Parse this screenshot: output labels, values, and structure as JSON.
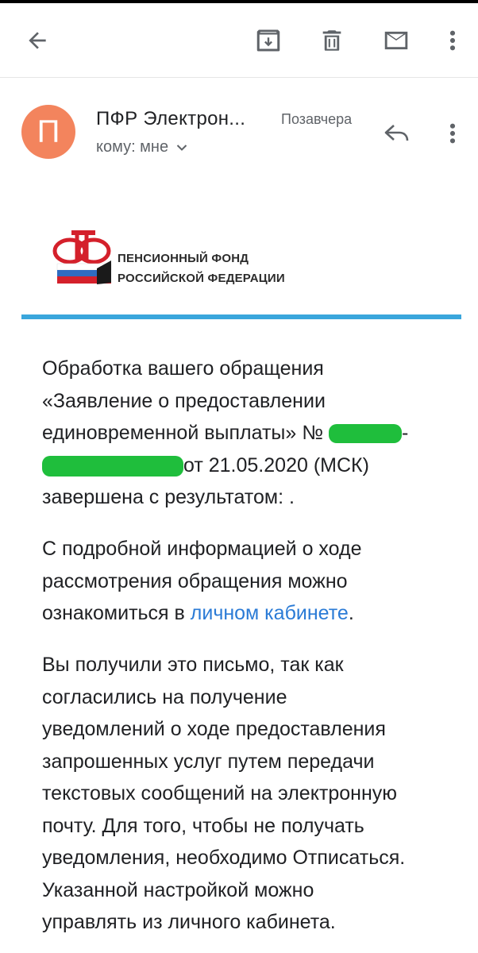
{
  "toolbar": {
    "back_icon": "arrow-left-icon",
    "archive_icon": "archive-icon",
    "delete_icon": "trash-icon",
    "mail_icon": "mail-icon",
    "more_icon": "more-vert-icon"
  },
  "message": {
    "avatar_letter": "П",
    "avatar_color": "#f3845d",
    "sender": "ПФР Электрон...",
    "date": "Позавчера",
    "recipient": "кому: мне"
  },
  "logo": {
    "line1": "ПЕНСИОННЫЙ ФОНД",
    "line2": "РОССИЙСКОЙ ФЕДЕРАЦИИ"
  },
  "body": {
    "p1_line1": "Обработка вашего обращения",
    "p1_line2": "«Заявление о предоставлении",
    "p1_line3_a": "единовременной выплаты» №",
    "p1_line3_b": "-",
    "p1_line4_b": "от 21.05.2020 (МСК)",
    "p1_line5": "завершена с результатом: .",
    "p2_line1": "С подробной информацией о ходе",
    "p2_line2": "рассмотрения обращения можно",
    "p2_line3_a": "ознакомиться в",
    "p2_link": "личном кабинете",
    "p2_line3_b": ".",
    "p3_line1": "Вы получили это письмо, так как",
    "p3_line2": "согласились на получение",
    "p3_line3": "уведомлений о ходе предоставления",
    "p3_line4": "запрошенных услуг путем передачи",
    "p3_line5": "текстовых сообщений на электронную",
    "p3_line6": "почту. Для того, чтобы не получать",
    "p3_line7": "уведомления, необходимо Отписаться.",
    "p3_line8": "Указанной настройкой можно",
    "p3_line9": "управлять из личного кабинета."
  },
  "colors": {
    "accent_rule": "#3aa6dc",
    "link": "#2b7bd6",
    "redaction": "#1fbe3c"
  }
}
